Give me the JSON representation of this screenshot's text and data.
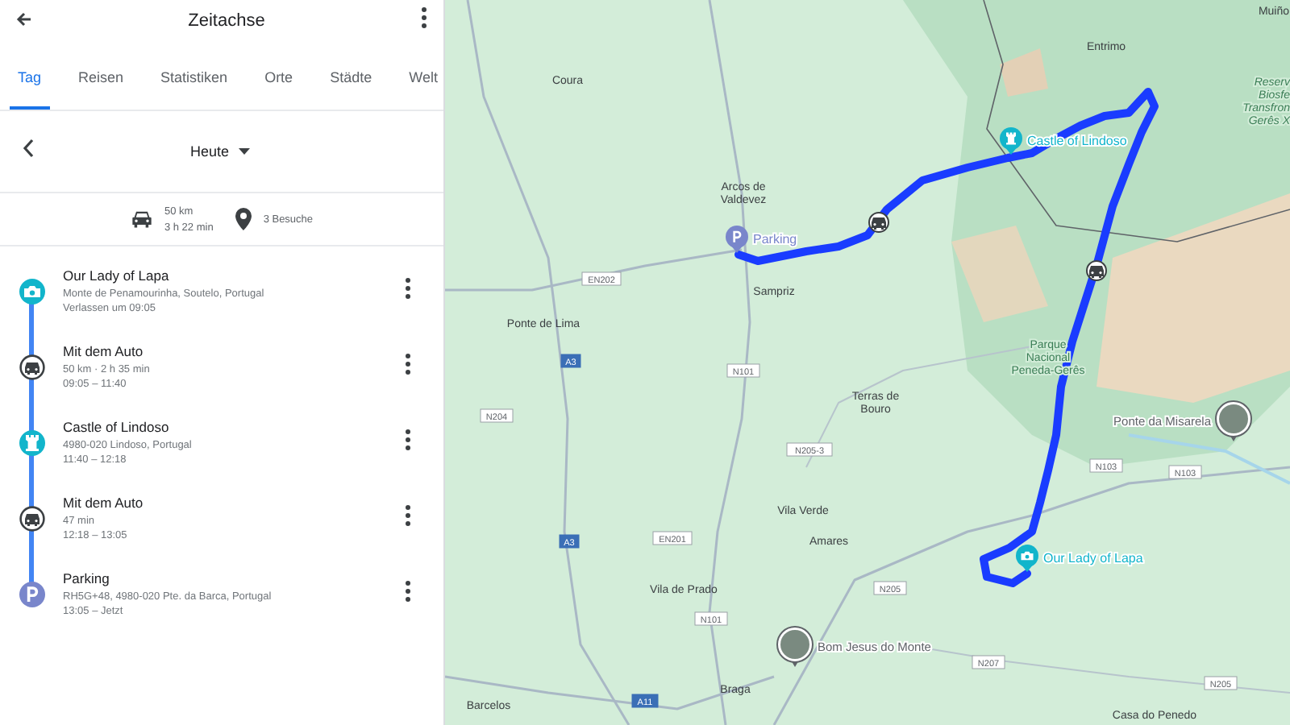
{
  "sidebar": {
    "title": "Zeitachse",
    "tabs": [
      {
        "label": "Tag",
        "selected": true
      },
      {
        "label": "Reisen",
        "selected": false
      },
      {
        "label": "Statistiken",
        "selected": false
      },
      {
        "label": "Orte",
        "selected": false
      },
      {
        "label": "Städte",
        "selected": false
      },
      {
        "label": "Welt",
        "selected": false
      }
    ],
    "date": "Heute",
    "summary": {
      "distance": "50 km",
      "duration": "3 h 22 min",
      "visits": "3 Besuche"
    },
    "entries": [
      {
        "kind": "viewpoint",
        "color": "#12b5cb",
        "title": "Our Lady of Lapa",
        "lines": [
          "Monte de Penamourinha, Soutelo, Portugal",
          "Verlassen um 09:05"
        ]
      },
      {
        "kind": "drive",
        "title": "Mit dem Auto",
        "lines": [
          "50 km · 2 h 35 min",
          "09:05 – 11:40"
        ]
      },
      {
        "kind": "castle",
        "color": "#12b5cb",
        "title": "Castle of Lindoso",
        "lines": [
          "4980-020 Lindoso, Portugal",
          "11:40 – 12:18"
        ]
      },
      {
        "kind": "drive",
        "title": "Mit dem Auto",
        "lines": [
          "47 min",
          "12:18 – 13:05"
        ]
      },
      {
        "kind": "parking",
        "color": "#7986cb",
        "title": "Parking",
        "lines": [
          "RH5G+48, 4980-020 Pte. da Barca, Portugal",
          "13:05 – Jetzt"
        ]
      }
    ]
  },
  "map": {
    "labels": [
      {
        "kind": "town",
        "lines": [
          "Coura"
        ]
      },
      {
        "kind": "town",
        "lines": [
          "Arcos de",
          "Valdevez"
        ]
      },
      {
        "kind": "town",
        "lines": [
          "Sampriz"
        ]
      },
      {
        "kind": "town",
        "lines": [
          "Ponte de Lima"
        ]
      },
      {
        "kind": "town",
        "lines": [
          "Entrimo"
        ]
      },
      {
        "kind": "town",
        "lines": [
          "Muiño"
        ]
      },
      {
        "kind": "park",
        "lines": [
          "Reserv",
          "Biosfe",
          "Transfron",
          "Gerês X"
        ]
      },
      {
        "kind": "park",
        "lines": [
          "Parque",
          "Nacional",
          "Peneda-Gerês"
        ]
      },
      {
        "kind": "town",
        "lines": [
          "Terras de",
          "Bouro"
        ]
      },
      {
        "kind": "town",
        "lines": [
          "Vila Verde"
        ]
      },
      {
        "kind": "town",
        "lines": [
          "Amares"
        ]
      },
      {
        "kind": "town",
        "lines": [
          "Vila de Prado"
        ]
      },
      {
        "kind": "town",
        "lines": [
          "Braga"
        ]
      },
      {
        "kind": "town",
        "lines": [
          "Barcelos"
        ]
      },
      {
        "kind": "town",
        "lines": [
          "Casa do Penedo"
        ]
      },
      {
        "kind": "road",
        "lines": [
          "EN202"
        ]
      },
      {
        "kind": "motorway",
        "lines": [
          "A3"
        ]
      },
      {
        "kind": "road",
        "lines": [
          "N101"
        ]
      },
      {
        "kind": "road",
        "lines": [
          "N204"
        ]
      },
      {
        "kind": "road",
        "lines": [
          "N205-3"
        ]
      },
      {
        "kind": "road",
        "lines": [
          "EN201"
        ]
      },
      {
        "kind": "motorway",
        "lines": [
          "A3"
        ]
      },
      {
        "kind": "road",
        "lines": [
          "N205"
        ]
      },
      {
        "kind": "road",
        "lines": [
          "N101"
        ]
      },
      {
        "kind": "road",
        "lines": [
          "N207"
        ]
      },
      {
        "kind": "road",
        "lines": [
          "N103"
        ]
      },
      {
        "kind": "road",
        "lines": [
          "N103"
        ]
      },
      {
        "kind": "road",
        "lines": [
          "N205"
        ]
      },
      {
        "kind": "motorway",
        "lines": [
          "A11"
        ]
      }
    ],
    "pins": [
      {
        "kind": "parking",
        "label": "Parking",
        "color": "#7986cb"
      },
      {
        "kind": "castle",
        "label": "Castle of Lindoso",
        "color": "#12b5cb"
      },
      {
        "kind": "camera",
        "label": "Our Lady of Lapa",
        "color": "#12b5cb"
      },
      {
        "kind": "photo",
        "label": "Ponte da Misarela"
      },
      {
        "kind": "photo",
        "label": "Bom Jesus do Monte"
      }
    ]
  }
}
